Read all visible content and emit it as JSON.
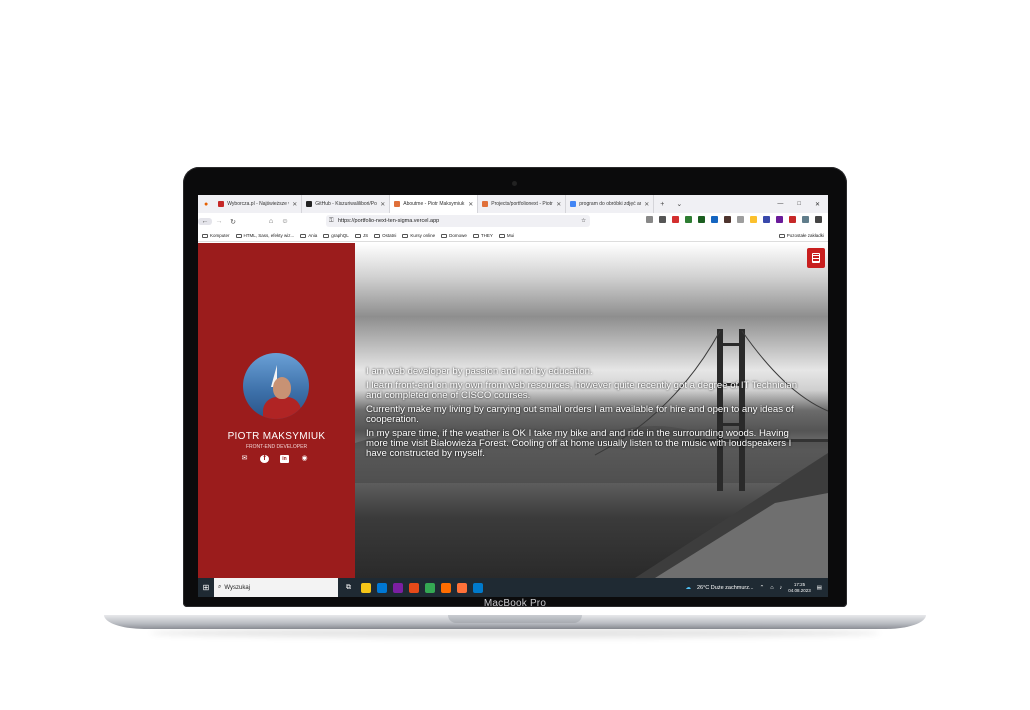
{
  "device": {
    "label": "MacBook Pro"
  },
  "browser": {
    "tabs": [
      {
        "label": "Wyborcza.pl - Najświeższe wia",
        "color": "#c62828",
        "active": false
      },
      {
        "label": "GitHub - Kiszuriwalilibori/Portf",
        "color": "#222222",
        "active": false
      },
      {
        "label": "Aboutme - Piotr Maksymiuk",
        "color": "#e0703a",
        "active": true
      },
      {
        "label": "Projects/portfolionext - Piotr M",
        "color": "#e0703a",
        "active": false
      },
      {
        "label": "program do obróbki zdjęć and",
        "color": "#4285f4",
        "active": false
      }
    ],
    "new_tab": "+",
    "tab_list": "⌄",
    "window_controls": [
      "—",
      "□",
      "✕"
    ],
    "back": "←",
    "forward": "→",
    "reload": "↻",
    "url": "https://portfolio-next-ten-sigma.vercel.app",
    "bookmarks": [
      "Komputer",
      "HTML, Sass, efekty wiz...",
      "Ania",
      "graphQL",
      "JS",
      "Ostatni",
      "Kursy online",
      "Domowe",
      "THEY",
      "Mui"
    ],
    "bookmarks_right": "Pozostałe zakładki",
    "extension_colors": [
      "#888888",
      "#555555",
      "#d32f2f",
      "#2e7d32",
      "#1b5e20",
      "#1565c0",
      "#4e342e",
      "#9e9e9e",
      "#fbc02d",
      "#3949ab",
      "#6a1b9a",
      "#c62828",
      "#607d8b",
      "#444444"
    ]
  },
  "page": {
    "name": "PIOTR MAKSYMIUK",
    "role": "FRONT-END DEVELOPER",
    "socials": [
      "mail-icon",
      "facebook-icon",
      "linkedin-icon",
      "github-icon"
    ],
    "socials_glyphs": [
      "✉",
      "f",
      "in",
      "◉"
    ],
    "about": [
      "I am web developer by passion and not by education.",
      "I learn front-end on my own from web resources, however quite recently got a degree of IT Technician and completed one of CISCO courses.",
      "Currently make my living by carrying out small orders I am available for hire and open to any ideas of cooperation.",
      "In my spare time, if the weather is OK I take my bike and and ride in the surrounding woods. Having more time visit Białowieża Forest. Cooling off at home usually listen to the music with loudspeakers I have constructed by myself."
    ],
    "accent": "#9b1c1c",
    "menu_button_color": "#c81e1e"
  },
  "taskbar": {
    "search_placeholder": "Wyszukaj",
    "weather": "26°C  Duże zachmurz...",
    "time": "17:25",
    "date": "04.08.2023",
    "app_colors": [
      "#f5c518",
      "#0078d4",
      "#7b1fa2",
      "#e64a19",
      "#34a853",
      "#ff6d00",
      "#ff7139",
      "#007acc"
    ]
  }
}
